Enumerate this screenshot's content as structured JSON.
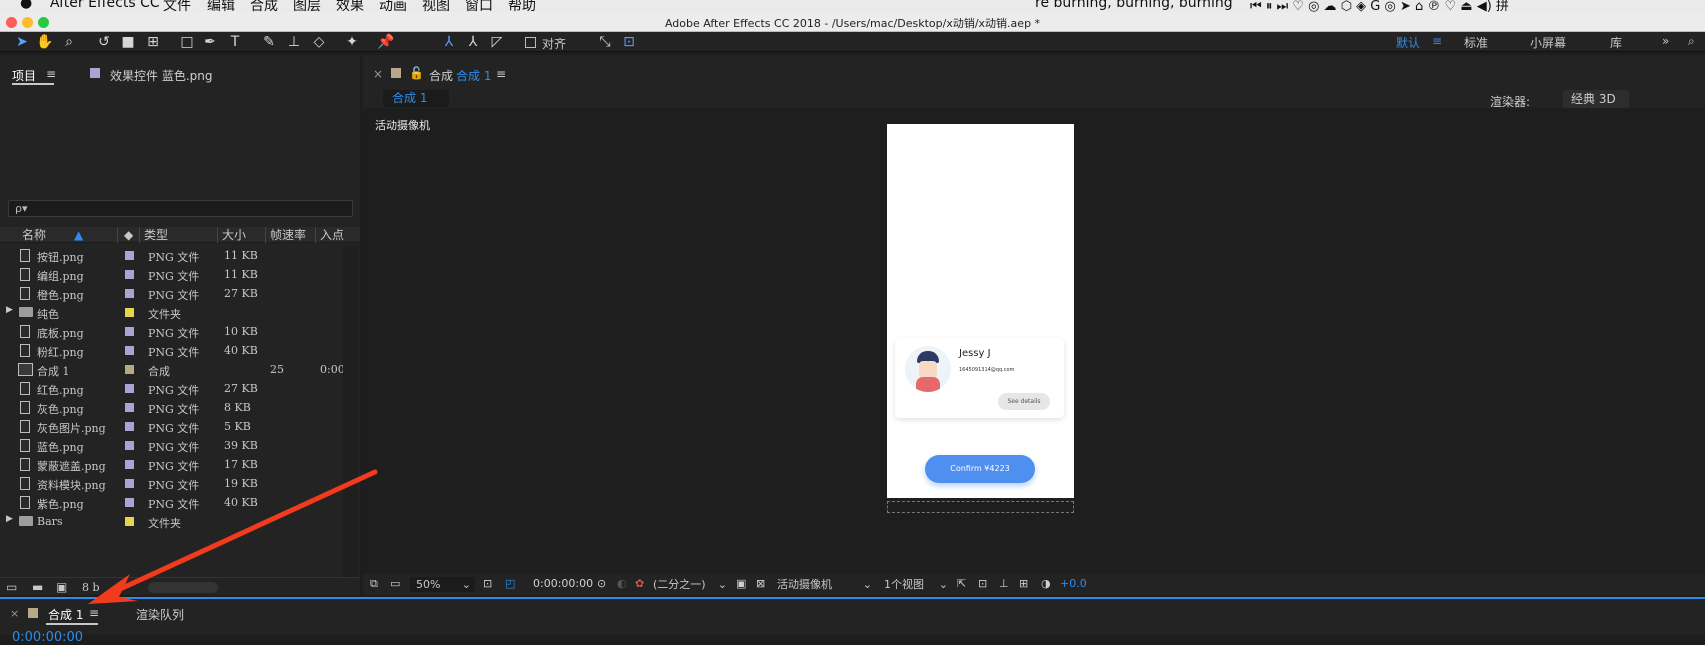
{
  "macos_menu": {
    "app_name": "After Effects CC",
    "items": [
      "文件",
      "编辑",
      "合成",
      "图层",
      "效果",
      "动画",
      "视图",
      "窗口",
      "帮助"
    ],
    "now_playing": "re burning, burning, burning"
  },
  "window": {
    "title": "Adobe After Effects CC 2018 - /Users/mac/Desktop/x动销/x动销.aep *"
  },
  "toolbar": {
    "align_label": "对齐",
    "workspaces": [
      "默认",
      "标准",
      "小屏幕",
      "库"
    ],
    "active_workspace": "默认",
    "more": "»"
  },
  "project_panel": {
    "tab_project": "项目",
    "tab_effects": "效果控件 蓝色.png",
    "search_placeholder": "ρ▾",
    "columns": [
      "名称",
      "类型",
      "大小",
      "帧速率",
      "入点"
    ],
    "rows": [
      {
        "name": "按钮.png",
        "type": "PNG 文件",
        "size": "11 KB",
        "fps": "",
        "in": "",
        "kind": "file",
        "color": "#a9a4d4"
      },
      {
        "name": "编组.png",
        "type": "PNG 文件",
        "size": "11 KB",
        "fps": "",
        "in": "",
        "kind": "file",
        "color": "#a9a4d4"
      },
      {
        "name": "橙色.png",
        "type": "PNG 文件",
        "size": "27 KB",
        "fps": "",
        "in": "",
        "kind": "file",
        "color": "#a9a4d4"
      },
      {
        "name": "纯色",
        "type": "文件夹",
        "size": "",
        "fps": "",
        "in": "",
        "kind": "folder",
        "color": "#e8d44a"
      },
      {
        "name": "底板.png",
        "type": "PNG 文件",
        "size": "10 KB",
        "fps": "",
        "in": "",
        "kind": "file",
        "color": "#a9a4d4"
      },
      {
        "name": "粉红.png",
        "type": "PNG 文件",
        "size": "40 KB",
        "fps": "",
        "in": "",
        "kind": "file",
        "color": "#a9a4d4"
      },
      {
        "name": "合成 1",
        "type": "合成",
        "size": "",
        "fps": "25",
        "in": "0:00:",
        "kind": "comp",
        "color": "#b8a88a"
      },
      {
        "name": "红色.png",
        "type": "PNG 文件",
        "size": "27 KB",
        "fps": "",
        "in": "",
        "kind": "file",
        "color": "#a9a4d4"
      },
      {
        "name": "灰色.png",
        "type": "PNG 文件",
        "size": "8 KB",
        "fps": "",
        "in": "",
        "kind": "file",
        "color": "#a9a4d4"
      },
      {
        "name": "灰色图片.png",
        "type": "PNG 文件",
        "size": "5 KB",
        "fps": "",
        "in": "",
        "kind": "file",
        "color": "#a9a4d4"
      },
      {
        "name": "蓝色.png",
        "type": "PNG 文件",
        "size": "39 KB",
        "fps": "",
        "in": "",
        "kind": "file",
        "color": "#a9a4d4"
      },
      {
        "name": "蒙蔽遮盖.png",
        "type": "PNG 文件",
        "size": "17 KB",
        "fps": "",
        "in": "",
        "kind": "file",
        "color": "#a9a4d4"
      },
      {
        "name": "资料模块.png",
        "type": "PNG 文件",
        "size": "19 KB",
        "fps": "",
        "in": "",
        "kind": "file",
        "color": "#a9a4d4"
      },
      {
        "name": "紫色.png",
        "type": "PNG 文件",
        "size": "40 KB",
        "fps": "",
        "in": "",
        "kind": "file",
        "color": "#a9a4d4"
      },
      {
        "name": "Bars",
        "type": "文件夹",
        "size": "",
        "fps": "",
        "in": "",
        "kind": "folder",
        "color": "#e8d44a"
      }
    ],
    "bpc": "8 b"
  },
  "comp_panel": {
    "tab_label": "合成",
    "tab_name": "合成 1",
    "breadcrumb": "合成 1",
    "renderer_label": "渲染器:",
    "renderer_value": "经典 3D",
    "camera_label": "活动摄像机"
  },
  "phone": {
    "name": "Jessy J",
    "email": "1645091314@qq.com",
    "details_button": "See details",
    "confirm_button": "Confirm ¥4223",
    "accent": "#4f8ff0"
  },
  "viewer_footer": {
    "zoom": "50%",
    "timecode": "0:00:00:00",
    "resolution": "(二分之一)",
    "camera": "活动摄像机",
    "views": "1个视图",
    "exposure": "+0.0"
  },
  "timeline": {
    "tab_comp": "合成 1",
    "tab_render": "渲染队列",
    "timecode": "0:00:00:00"
  },
  "colors": {
    "accent_blue": "#2d8ceb",
    "panel_bg": "#232323"
  }
}
